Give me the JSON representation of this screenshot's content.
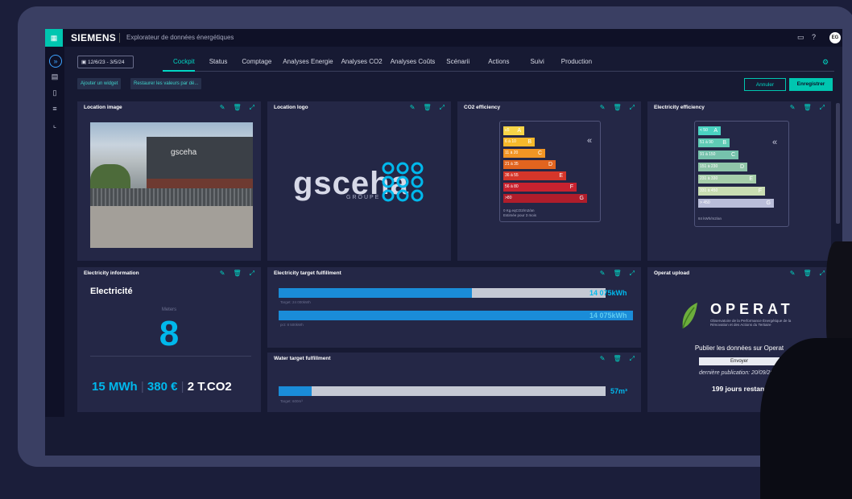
{
  "header": {
    "brand": "SIEMENS",
    "title": "Explorateur de données énergétiques",
    "avatar": "EG"
  },
  "toolbar": {
    "date_range": "12/6/23 - 3/5/24",
    "tabs": [
      "Cockpit",
      "Status",
      "Comptage",
      "Analyses Energie",
      "Analyses CO2",
      "Analyses Coûts",
      "Scénarii",
      "Actions",
      "Suivi",
      "Production"
    ],
    "add_widget": "Ajouter un widget",
    "restore": "Restaurer les valeurs par dé...",
    "cancel": "Annuler",
    "save": "Enregistrer"
  },
  "cards": {
    "location_image": {
      "title": "Location image",
      "building_text": "gsceha"
    },
    "location_logo": {
      "title": "Location logo",
      "word": "gsceha",
      "sub": "GROUPE"
    },
    "co2": {
      "title": "CO2 efficiency",
      "bars": [
        {
          "label": "≤5",
          "letter": "A",
          "color": "#f7d548"
        },
        {
          "label": "6 à 10",
          "letter": "B",
          "color": "#f6b92b"
        },
        {
          "label": "11 à 20",
          "letter": "C",
          "color": "#f19524"
        },
        {
          "label": "21 à 35",
          "letter": "D",
          "color": "#e1641f"
        },
        {
          "label": "36 à 55",
          "letter": "E",
          "color": "#d5362a"
        },
        {
          "label": "56 à 80",
          "letter": "F",
          "color": "#c8222f"
        },
        {
          "label": ">80",
          "letter": "G",
          "color": "#b01d2b"
        }
      ],
      "note1": "0 Kg.eqCO2/m2/an",
      "note2": "Estimée pour 3 mois"
    },
    "elec_eff": {
      "title": "Electricity efficiency",
      "bars": [
        {
          "label": "< 50",
          "letter": "A",
          "color": "#4ad2c1"
        },
        {
          "label": "51 à 90",
          "letter": "B",
          "color": "#5fcbb5"
        },
        {
          "label": "91 à 150",
          "letter": "C",
          "color": "#76c2ac"
        },
        {
          "label": "151 à 230",
          "letter": "D",
          "color": "#8fc5a9"
        },
        {
          "label": "231 à 330",
          "letter": "E",
          "color": "#a6ceaa"
        },
        {
          "label": "331 à 450",
          "letter": "F",
          "color": "#c9ddb2"
        },
        {
          "label": "> 450",
          "letter": "G",
          "color": "#b9bdd9"
        }
      ],
      "note": "84 kWh/m2/an"
    },
    "elec_info": {
      "title": "Electricity information",
      "heading": "Electricité",
      "meters_label": "Meters",
      "meters": "8",
      "mwh": "15 MWh",
      "eur": "380 €",
      "co2": "2 T.CO2"
    },
    "elec_target": {
      "title": "Electricity target fulfillment",
      "bar1_value": "14 075kWh",
      "bar1_target": "Target: 24 000kWh",
      "bar1_fill": 0.59,
      "bar2_value": "14 075kWh",
      "bar2_target": "pct: 8 500kWh",
      "bar2_fill": 1.0
    },
    "water_target": {
      "title": "Water target fulfillment",
      "value": "57m³",
      "target": "Target: 600m³",
      "fill": 0.1
    },
    "operat": {
      "title": "Operat upload",
      "word": "OPERAT",
      "sub": "Observatoire de la Performance Énergétique de la Rénovation et des Actions du Tertiaire",
      "publish": "Publier les données sur Operat",
      "send": "Envoyer",
      "last": "dernière publication: 20/09/2023",
      "days": "199 jours restant"
    }
  }
}
